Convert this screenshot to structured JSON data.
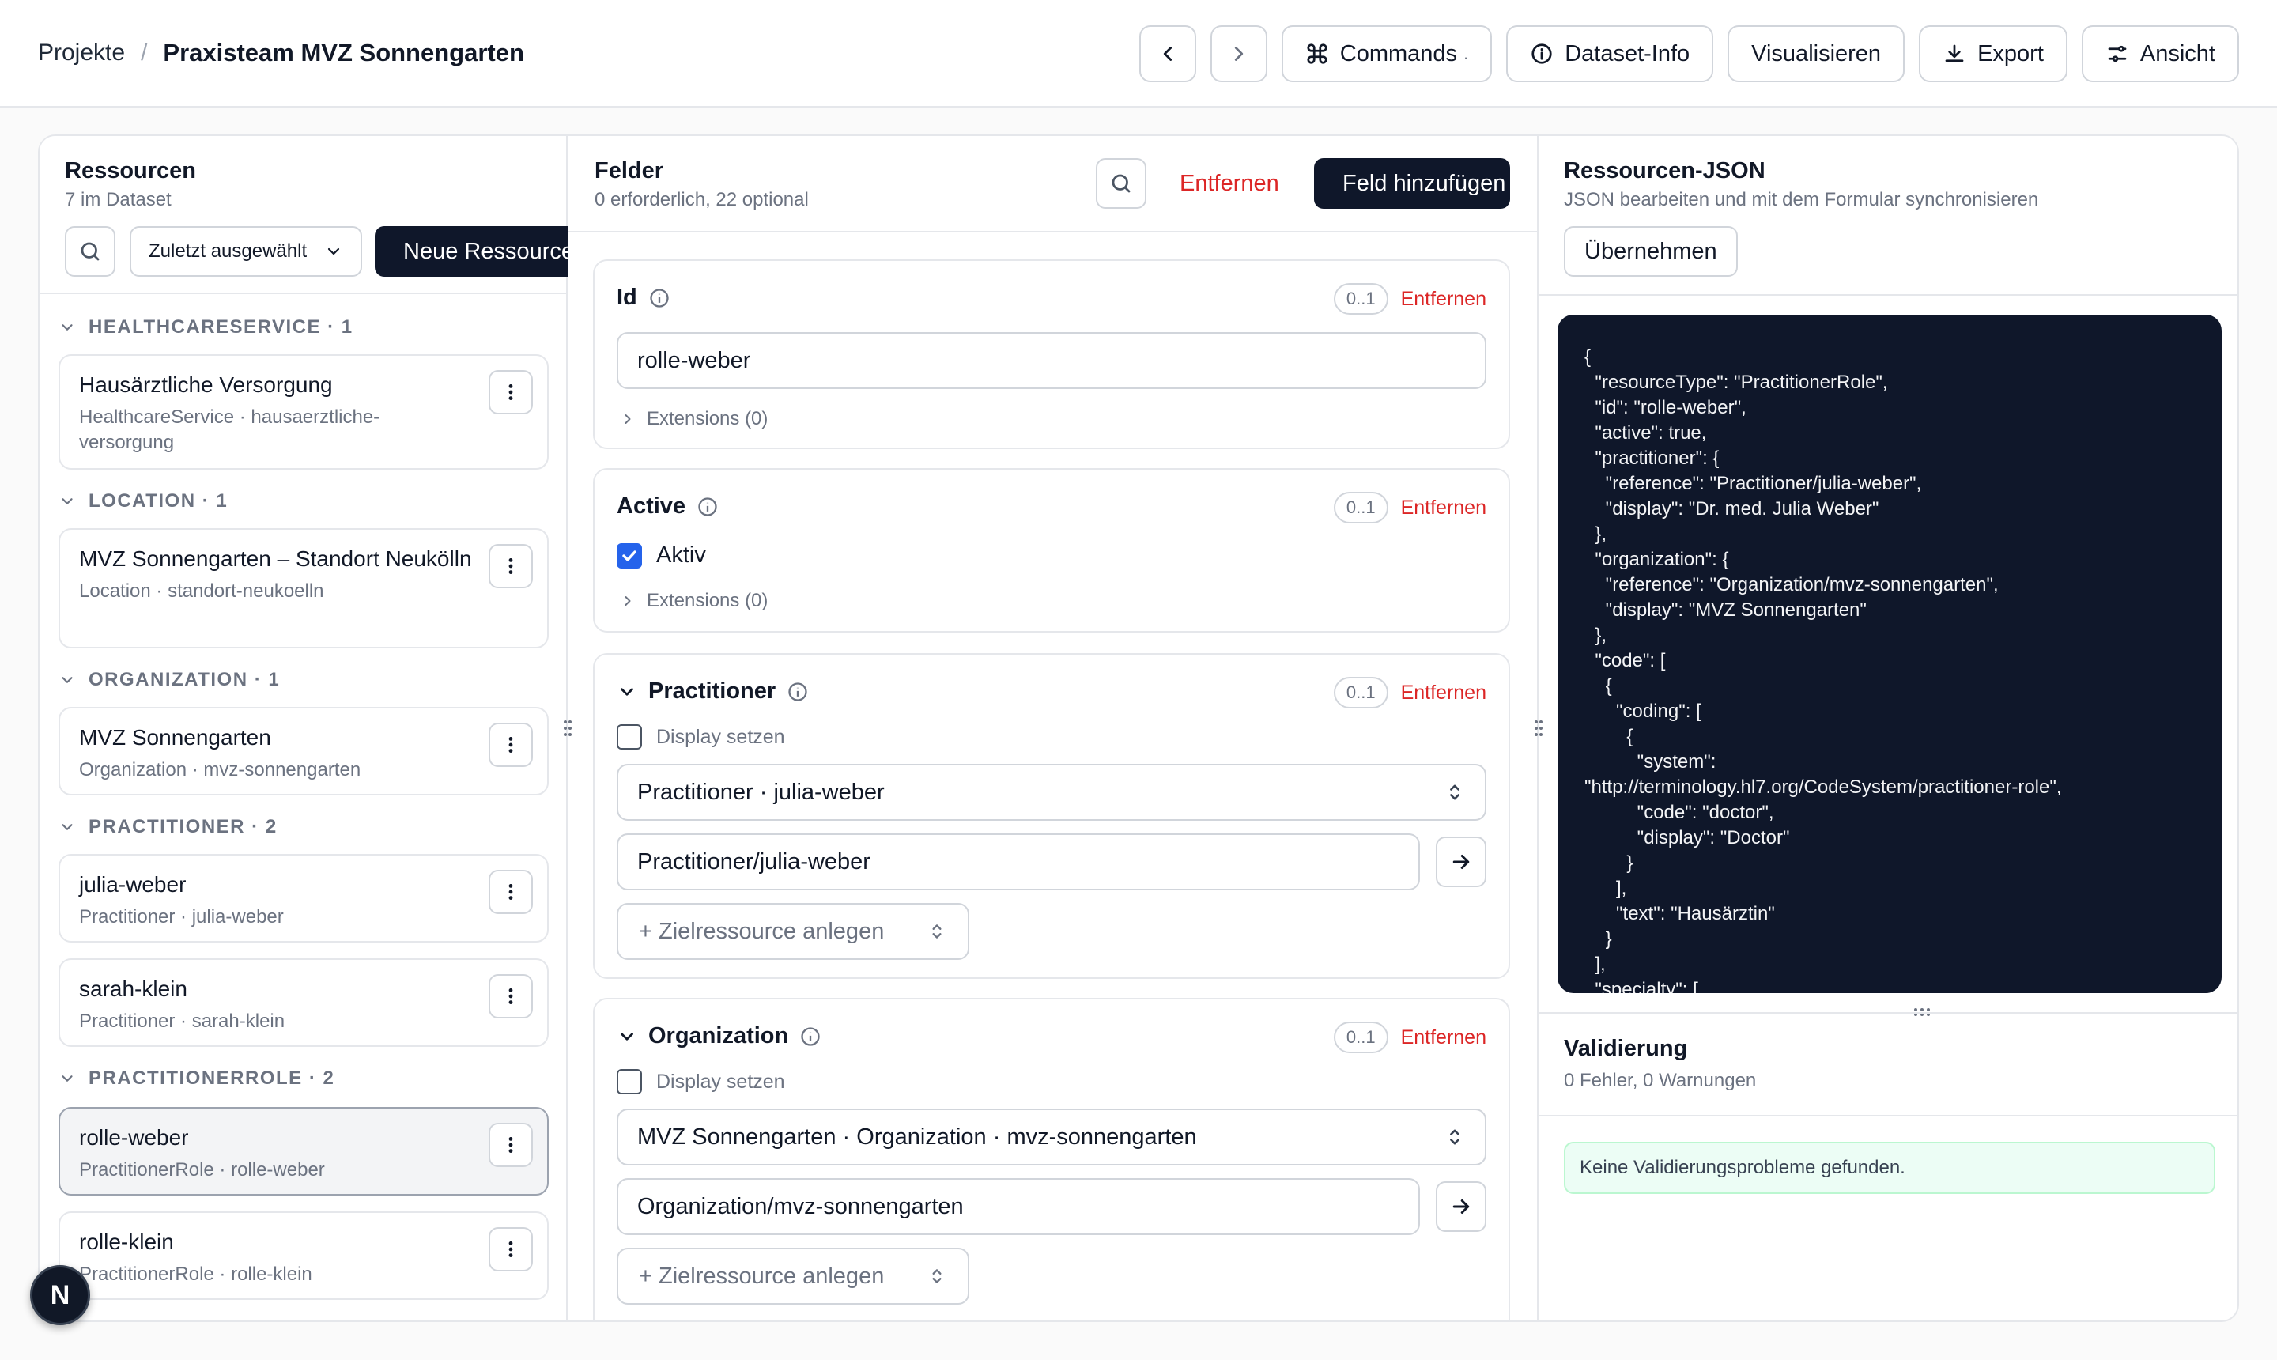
{
  "breadcrumb": {
    "root": "Projekte",
    "separator": "/",
    "current": "Praxisteam MVZ Sonnengarten"
  },
  "toolbar": {
    "commands": "Commands",
    "commands_hint": ".",
    "dataset_info": "Dataset-Info",
    "visualize": "Visualisieren",
    "export": "Export",
    "view": "Ansicht"
  },
  "resources": {
    "title": "Ressourcen",
    "subtitle": "7 im Dataset",
    "sort_select": "Zuletzt ausgewählt",
    "new_button": "Neue Ressource",
    "groups": [
      {
        "label": "HEALTHCARESERVICE · 1",
        "items": [
          {
            "title": "Hausärztliche Versorgung",
            "sub": "HealthcareService · hausaerztliche-versorgung"
          }
        ]
      },
      {
        "label": "LOCATION · 1",
        "items": [
          {
            "title": "MVZ Sonnengarten – Standort Neukölln",
            "sub": "Location · standort-neukoelln"
          }
        ]
      },
      {
        "label": "ORGANIZATION · 1",
        "items": [
          {
            "title": "MVZ Sonnengarten",
            "sub": "Organization · mvz-sonnengarten"
          }
        ]
      },
      {
        "label": "PRACTITIONER · 2",
        "items": [
          {
            "title": "julia-weber",
            "sub": "Practitioner · julia-weber"
          },
          {
            "title": "sarah-klein",
            "sub": "Practitioner · sarah-klein"
          }
        ]
      },
      {
        "label": "PRACTITIONERROLE · 2",
        "items": [
          {
            "title": "rolle-weber",
            "sub": "PractitionerRole · rolle-weber"
          },
          {
            "title": "rolle-klein",
            "sub": "PractitionerRole · rolle-klein"
          }
        ]
      }
    ]
  },
  "fields": {
    "title": "Felder",
    "subtitle": "0 erforderlich, 22 optional",
    "remove": "Entfernen",
    "add_field": "Feld hinzufügen",
    "cards": {
      "id": {
        "label": "Id",
        "card": "0..1",
        "remove": "Entfernen",
        "value": "rolle-weber",
        "extensions": "Extensions (0)"
      },
      "active": {
        "label": "Active",
        "card": "0..1",
        "remove": "Entfernen",
        "checkbox_label": "Aktiv",
        "checked": true,
        "extensions": "Extensions (0)"
      },
      "practitioner": {
        "label": "Practitioner",
        "card": "0..1",
        "remove": "Entfernen",
        "display_label": "Display setzen",
        "select": "Practitioner · julia-weber",
        "reference": "Practitioner/julia-weber",
        "create": "+ Zielressource anlegen"
      },
      "organization": {
        "label": "Organization",
        "card": "0..1",
        "remove": "Entfernen",
        "display_label": "Display setzen",
        "select": "MVZ Sonnengarten · Organization · mvz-sonnengarten",
        "reference": "Organization/mvz-sonnengarten",
        "create": "+ Zielressource anlegen"
      }
    }
  },
  "json_panel": {
    "title": "Ressourcen-JSON",
    "subtitle": "JSON bearbeiten und mit dem Formular synchronisieren",
    "apply": "Übernehmen",
    "content": "{\n  \"resourceType\": \"PractitionerRole\",\n  \"id\": \"rolle-weber\",\n  \"active\": true,\n  \"practitioner\": {\n    \"reference\": \"Practitioner/julia-weber\",\n    \"display\": \"Dr. med. Julia Weber\"\n  },\n  \"organization\": {\n    \"reference\": \"Organization/mvz-sonnengarten\",\n    \"display\": \"MVZ Sonnengarten\"\n  },\n  \"code\": [\n    {\n      \"coding\": [\n        {\n          \"system\":\n\"http://terminology.hl7.org/CodeSystem/practitioner-role\",\n          \"code\": \"doctor\",\n          \"display\": \"Doctor\"\n        }\n      ],\n      \"text\": \"Hausärztin\"\n    }\n  ],\n  \"specialty\": ["
  },
  "validation": {
    "title": "Validierung",
    "subtitle": "0 Fehler, 0 Warnungen",
    "message": "Keine Validierungsprobleme gefunden."
  },
  "fab": {
    "label": "N"
  }
}
